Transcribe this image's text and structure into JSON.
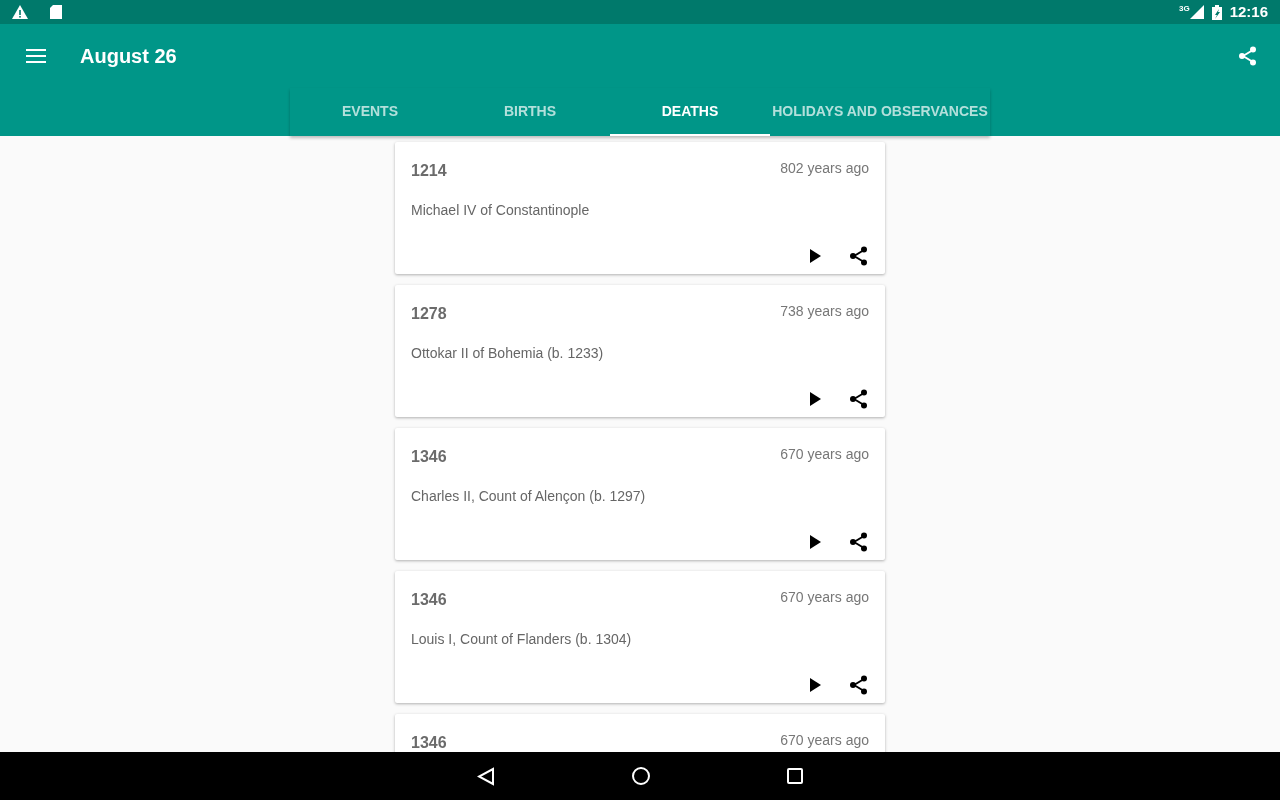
{
  "status_bar": {
    "network": "3G",
    "time": "12:16"
  },
  "app_bar": {
    "title": "August 26"
  },
  "tabs": [
    {
      "label": "EVENTS",
      "selected": false
    },
    {
      "label": "BIRTHS",
      "selected": false
    },
    {
      "label": "DEATHS",
      "selected": true
    },
    {
      "label": "HOLIDAYS AND OBSERVANCES",
      "selected": false
    }
  ],
  "cards": [
    {
      "year": "1214",
      "ago": "802 years ago",
      "text": "Michael IV of Constantinople"
    },
    {
      "year": "1278",
      "ago": "738 years ago",
      "text": "Ottokar II of Bohemia (b. 1233)"
    },
    {
      "year": "1346",
      "ago": "670 years ago",
      "text": "Charles II, Count of Alençon (b. 1297)"
    },
    {
      "year": "1346",
      "ago": "670 years ago",
      "text": "Louis I, Count of Flanders (b. 1304)"
    },
    {
      "year": "1346",
      "ago": "670 years ago"
    }
  ]
}
